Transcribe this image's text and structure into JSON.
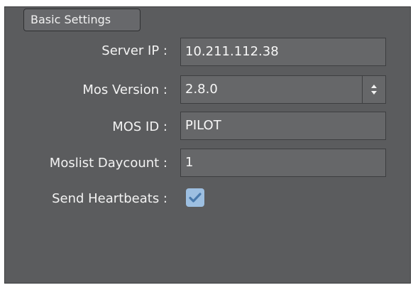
{
  "section": {
    "tab_label": "Basic Settings"
  },
  "fields": {
    "server_ip": {
      "label": "Server IP :",
      "value": "10.211.112.38"
    },
    "mos_version": {
      "label": "Mos Version :",
      "value": "2.8.0"
    },
    "mos_id": {
      "label": "MOS ID :",
      "value": "PILOT"
    },
    "moslist_daycount": {
      "label": "Moslist Daycount :",
      "value": "1"
    },
    "send_heartbeats": {
      "label": "Send Heartbeats :",
      "checked": true
    }
  },
  "colors": {
    "panel_bg": "#5b5c5e",
    "field_bg": "#666769",
    "checkbox_bg": "#9dbfe1",
    "checkmark": "#4a7aac"
  },
  "icons": {
    "spinner": "updown-spinner-icon",
    "check": "checkmark-icon"
  }
}
